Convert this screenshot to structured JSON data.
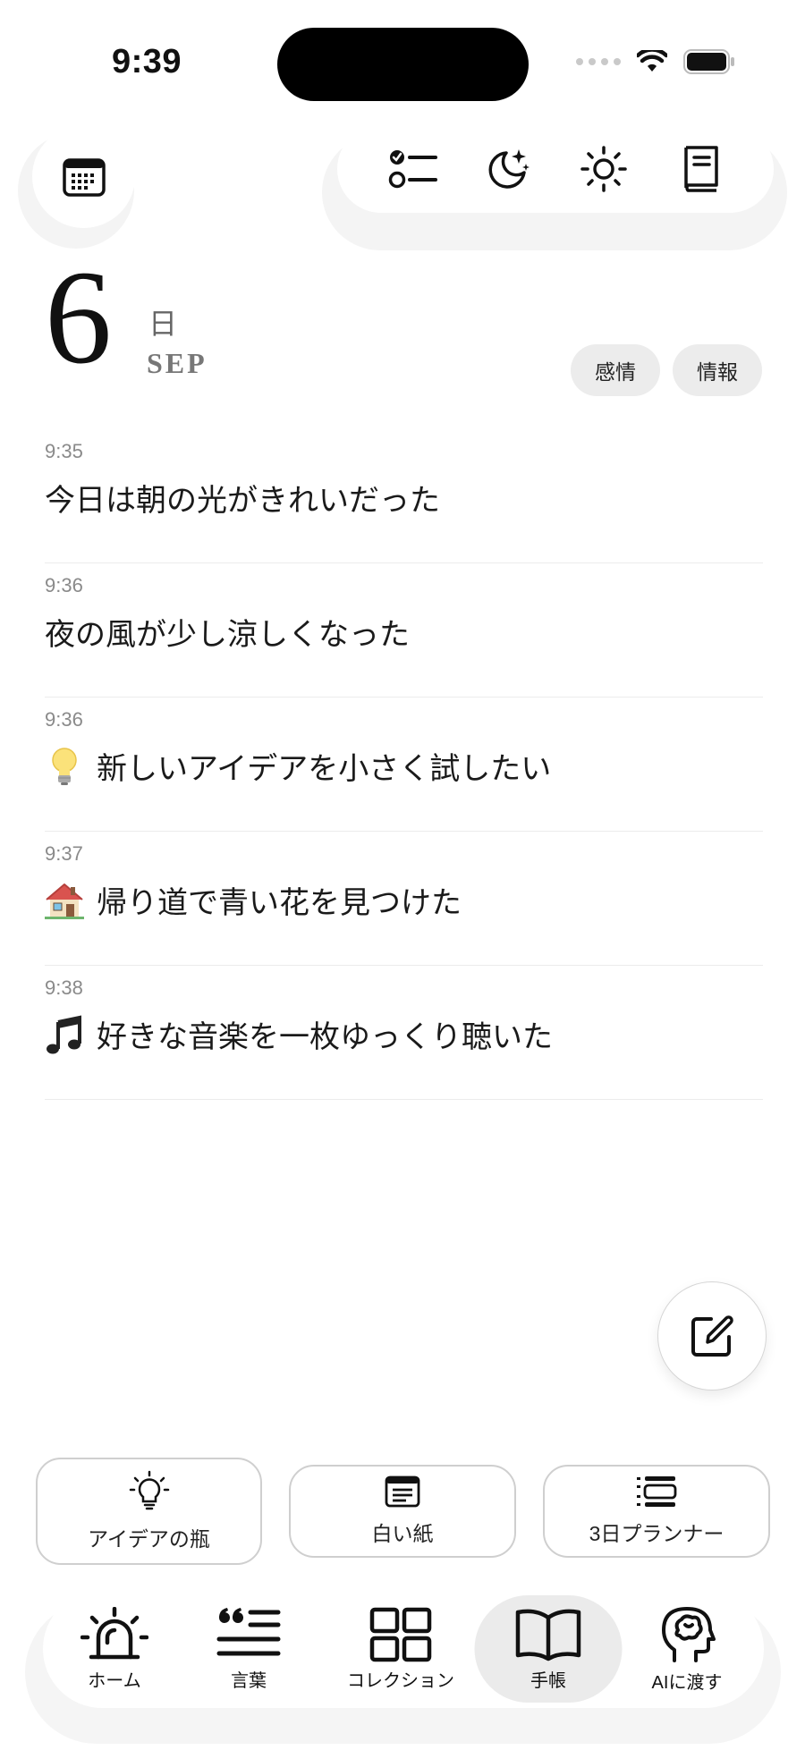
{
  "status_bar": {
    "time": "9:39"
  },
  "toolbar": {
    "calendar_icon": "calendar-icon",
    "icons": [
      "checklist-icon",
      "moon-stars-icon",
      "sun-icon",
      "book-icon"
    ]
  },
  "date": {
    "day": "6",
    "day_suffix": "日",
    "month": "SEP"
  },
  "tags": {
    "emotion": "感情",
    "info": "情報"
  },
  "entries": [
    {
      "time": "9:35",
      "emoji": "",
      "text": "今日は朝の光がきれいだった"
    },
    {
      "time": "9:36",
      "emoji": "",
      "text": "夜の風が少し涼しくなった"
    },
    {
      "time": "9:36",
      "emoji": "lightbulb",
      "text": "新しいアイデアを小さく試したい"
    },
    {
      "time": "9:37",
      "emoji": "house",
      "text": "帰り道で青い花を見つけた"
    },
    {
      "time": "9:38",
      "emoji": "music-note",
      "text": "好きな音楽を一枚ゆっくり聴いた"
    }
  ],
  "shortcuts": {
    "idea_jar": "アイデアの瓶",
    "white_paper": "白い紙",
    "planner": "3日プランナー"
  },
  "nav": {
    "home": "ホーム",
    "words": "言葉",
    "collection": "コレクション",
    "notebook": "手帳",
    "ai": "AIに渡す",
    "active": "notebook"
  },
  "colors": {
    "tag_bg": "#ececec",
    "active_nav_bg": "#ebebeb",
    "divider": "#ececec"
  }
}
